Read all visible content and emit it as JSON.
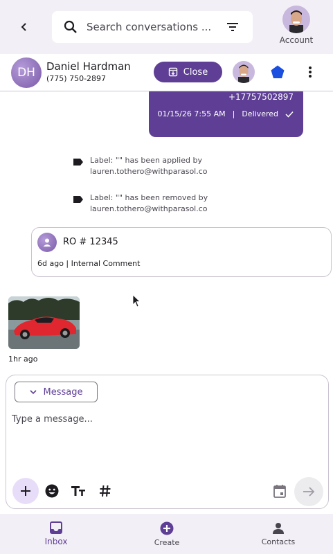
{
  "colors": {
    "brand": "#5e3f95",
    "surface": "#f3eff6",
    "outline": "#cac4d0",
    "assignee_tag": "#1a4fe0"
  },
  "topbar": {
    "back_icon": "chevron-left-icon",
    "search_placeholder": "Search conversations ...",
    "filter_icon": "filter-icon",
    "account_label": "Account"
  },
  "contact": {
    "initials": "DH",
    "name": "Daniel Hardman",
    "phone": "(775) 750-2897",
    "close_label": "Close"
  },
  "conversation": {
    "outgoing": {
      "to": "+17757502897",
      "timestamp": "01/15/26 7:55 AM",
      "separator": "|",
      "status": "Delivered"
    },
    "events": [
      {
        "text": "Label: \"\" has been applied by lauren.tothero@withparasol.co"
      },
      {
        "text": "Label: \"\" has been removed by lauren.tothero@withparasol.co"
      }
    ],
    "comment": {
      "title": "RO # 12345",
      "meta": "6d ago | Internal Comment"
    },
    "media": {
      "time": "1hr ago"
    }
  },
  "composer": {
    "type_label": "Message",
    "placeholder": "Type a message..."
  },
  "nav": {
    "items": [
      {
        "label": "Inbox",
        "icon": "inbox-icon"
      },
      {
        "label": "Create",
        "icon": "add-circle-icon"
      },
      {
        "label": "Contacts",
        "icon": "person-icon"
      }
    ]
  }
}
